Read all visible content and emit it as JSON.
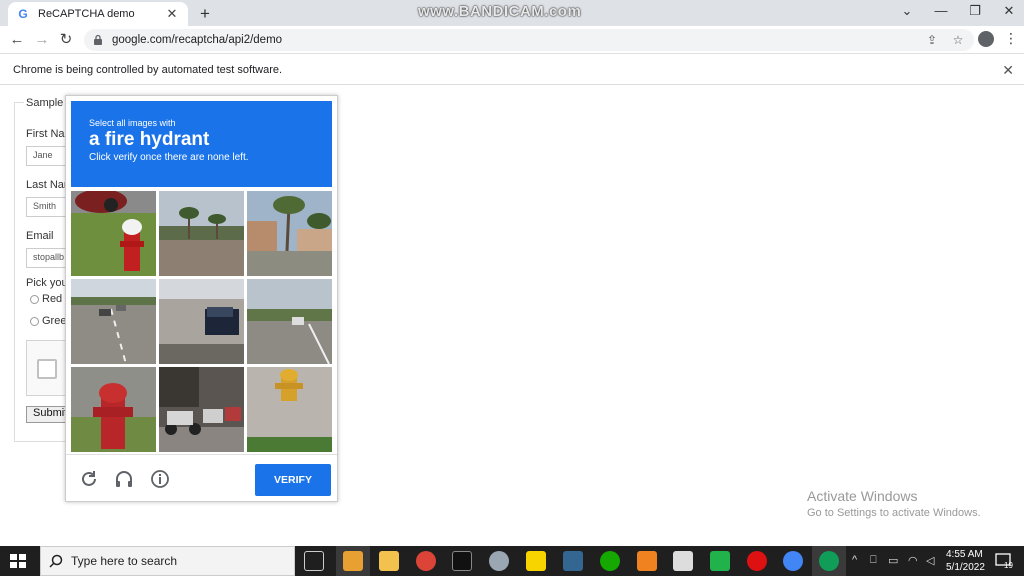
{
  "browser": {
    "tab_title": "ReCAPTCHA demo",
    "tab_favicon": "G",
    "url": "google.com/recaptcha/api2/demo",
    "infobar_text": "Chrome is being controlled by automated test software.",
    "watermark": "www.BANDICAM.com"
  },
  "form": {
    "legend": "Sample",
    "first_name_label": "First Nar",
    "first_name_value": "Jane",
    "last_name_label": "Last Nar",
    "last_name_value": "Smith",
    "email_label": "Email",
    "email_value": "stopallb",
    "pick_label": "Pick you",
    "radio_red": "Red",
    "radio_green": "Gree",
    "submit_label": "Submit"
  },
  "challenge": {
    "line1": "Select all images with",
    "target": "a fire hydrant",
    "line3": "Click verify once there are none left.",
    "verify_label": "VERIFY",
    "tiles": [
      "hydrant-grass",
      "street-palms",
      "building-palms",
      "road-cars",
      "parking-car",
      "road-trees",
      "hydrant-blurred",
      "scooters",
      "hydrant-gravel"
    ],
    "header_color": "#1a73e8"
  },
  "watermark_windows": {
    "title": "Activate Windows",
    "subtitle": "Go to Settings to activate Windows."
  },
  "taskbar": {
    "search_placeholder": "Type here to search",
    "time": "4:55 AM",
    "date": "5/1/2022",
    "notification_count": "19"
  }
}
